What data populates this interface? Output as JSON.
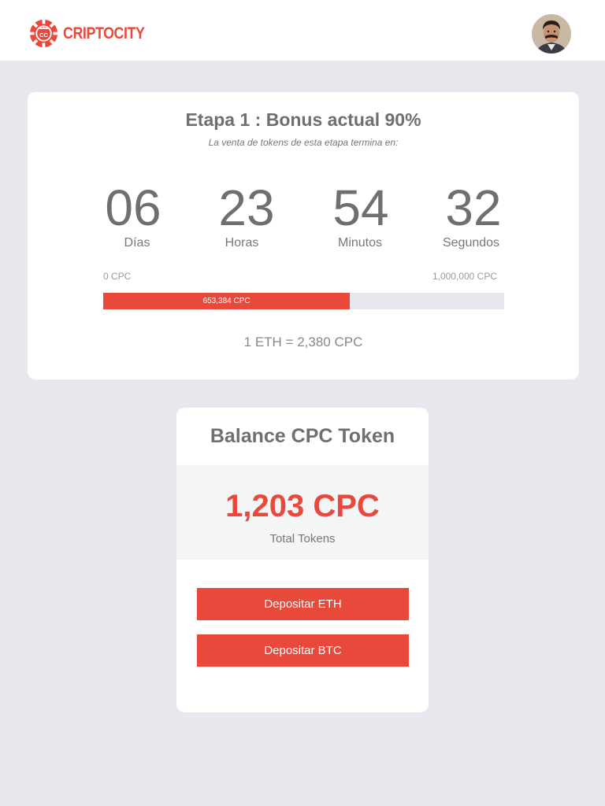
{
  "header": {
    "brand_name": "CRIPTOCITY",
    "logo_badge": "CC",
    "brand_color": "#e8493b"
  },
  "ico": {
    "stage_title": "Etapa 1 : Bonus actual 90%",
    "stage_subtitle": "La venta de tokens de esta etapa termina en:",
    "countdown": [
      {
        "value": "06",
        "label": "Días"
      },
      {
        "value": "23",
        "label": "Horas"
      },
      {
        "value": "54",
        "label": "Minutos"
      },
      {
        "value": "32",
        "label": "Segundos"
      }
    ],
    "progress": {
      "min_label": "0 CPC",
      "max_label": "1,000,000 CPC",
      "current_label": "653,384 CPC",
      "fraction": 0.6153
    },
    "rate": "1 ETH = 2,380 CPC"
  },
  "balance": {
    "title": "Balance CPC Token",
    "amount": "1,203 CPC",
    "amount_label": "Total Tokens",
    "deposit_eth_label": "Depositar ETH",
    "deposit_btc_label": "Depositar BTC"
  }
}
